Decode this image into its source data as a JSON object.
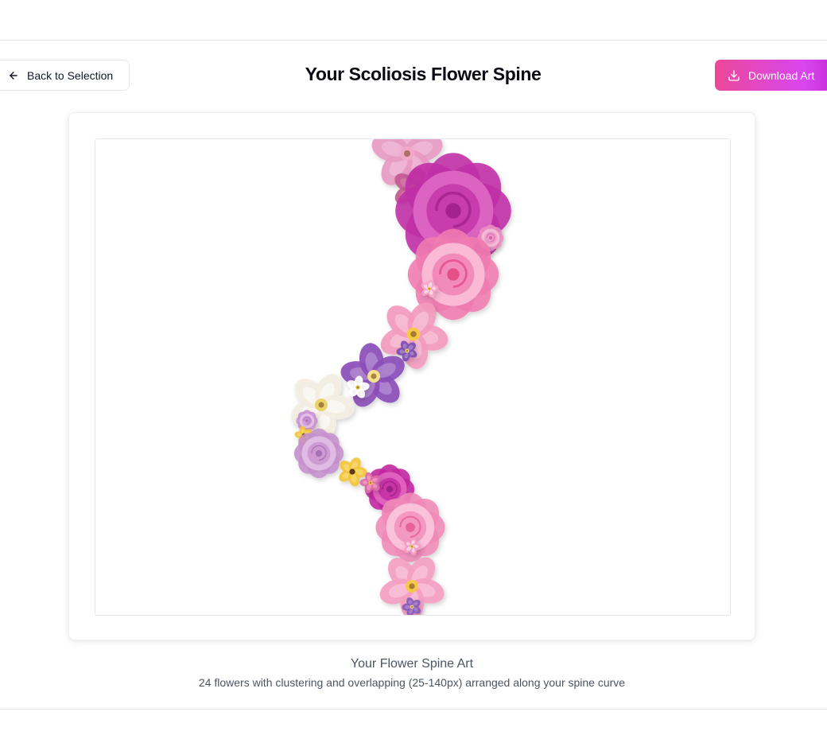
{
  "header": {
    "back_label": "Back to Selection",
    "title": "Your Scoliosis Flower Spine",
    "download_label": "Download Art"
  },
  "art": {
    "icons": {
      "back": "arrow-left-icon",
      "download": "download-icon"
    },
    "flower_count": 24
  },
  "caption": {
    "title": "Your Flower Spine Art",
    "subtitle": "24 flowers with clustering and overlapping (25-140px) arranged along your spine curve"
  },
  "colors": {
    "accent_start": "#ec4899",
    "accent_end": "#c026d3"
  }
}
